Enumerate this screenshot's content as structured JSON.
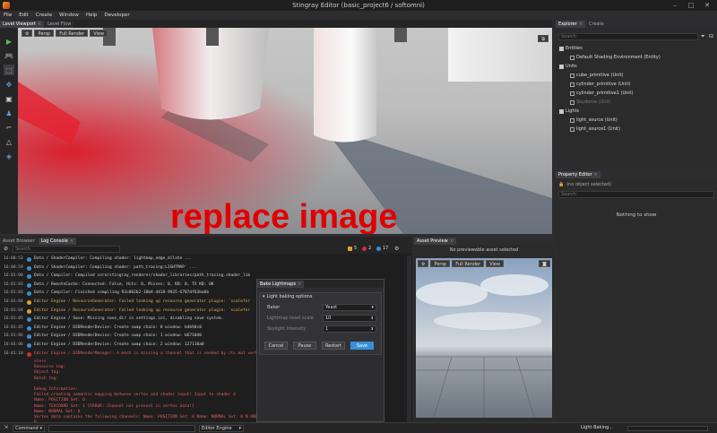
{
  "window": {
    "title": "Stingray Editor (basic_project6 / softomni)",
    "minimize": "–",
    "maximize": "□",
    "close": "✕"
  },
  "menu": [
    "File",
    "Edit",
    "Create",
    "Window",
    "Help",
    "Developer"
  ],
  "viewport_tabs": [
    "Level Viewport",
    "Level Flow"
  ],
  "viewport": {
    "mode": "Persp",
    "render": "Full Render",
    "view": "View",
    "overlay": "replace image"
  },
  "explorer": {
    "tabs": [
      "Explorer",
      "Create"
    ],
    "search_placeholder": "Search",
    "tree": [
      {
        "label": "Entities",
        "level": 0,
        "kind": "folder"
      },
      {
        "label": "Default Shading Environment (Entity)",
        "level": 1,
        "kind": "item"
      },
      {
        "label": "Units",
        "level": 0,
        "kind": "folder"
      },
      {
        "label": "cube_primitive (Unit)",
        "level": 1,
        "kind": "item"
      },
      {
        "label": "cylinder_primitive (Unit)",
        "level": 1,
        "kind": "item"
      },
      {
        "label": "cylinder_primitive1 (Unit)",
        "level": 1,
        "kind": "item"
      },
      {
        "label": "Skydome (Unit)",
        "level": 1,
        "kind": "item-dim"
      },
      {
        "label": "Lights",
        "level": 0,
        "kind": "folder"
      },
      {
        "label": "light_source (Unit)",
        "level": 1,
        "kind": "item"
      },
      {
        "label": "light_source1 (Unit)",
        "level": 1,
        "kind": "item"
      }
    ]
  },
  "property_editor": {
    "title": "Property Editor",
    "selection": "(no object selected)",
    "search_placeholder": "Search",
    "empty": "Nothing to show"
  },
  "bottom_tabs": [
    "Asset Browser",
    "Log Console"
  ],
  "log_toolbar": {
    "search_placeholder": "Search",
    "warnings": "5",
    "errors": "2",
    "infos": "17"
  },
  "log": [
    {
      "t": "16:00:53",
      "type": "info",
      "msg": "Data / ShaderCompiler: Compiling shader: lightmap_edge_dilate ..."
    },
    {
      "t": "16:00:59",
      "type": "info",
      "msg": "Data / ShaderCompiler: Compiling shader: path_tracing:LIGHTMAP' ..."
    },
    {
      "t": "16:01:00",
      "type": "info",
      "msg": "Data / Compiler: Compiled core/stingray_renderer/shader_libraries/path_tracing.shader_lib"
    },
    {
      "t": "16:01:03",
      "type": "info",
      "msg": "Data / RemoteCache: Connected: False, Hits: 0, Misses: 0, KB: 0, TX KB: 0K"
    },
    {
      "t": "16:01:03",
      "type": "info",
      "msg": "Data / Compiler: Finished compiling  93c002b2-10b4-4418-9935-6707df63ba6b"
    },
    {
      "t": "16:01:04",
      "type": "warn",
      "msg": "Editor Engine / ResourceGenerator: Failed looking up resource generator plugin: `scalefor"
    },
    {
      "t": "16:01:04",
      "type": "warn",
      "msg": "Editor Engine / ResourceGenerator: Failed looking up resource generator plugin: `scalefor"
    },
    {
      "t": "16:01:05",
      "type": "info",
      "msg": "Editor Engine / Save: Missing save_dir in settings.ini, disabling save system."
    },
    {
      "t": "16:01:05",
      "type": "info",
      "msg": "Editor Engine / D3DRenderDevice: Create swap chain: 0 window: b4b9dc0"
    },
    {
      "t": "16:01:06",
      "type": "info",
      "msg": "Editor Engine / D3DRenderDevice: Create swap chain: 1 window: b6710d0"
    },
    {
      "t": "16:01:06",
      "type": "info",
      "msg": "Editor Engine / D3DRenderDevice: Create swap chain: 2 window: 127110a0"
    },
    {
      "t": "16:01:10",
      "type": "err",
      "msg": "Editor Engine / D3DRenderManager: A mesh is missing a channel that is needed by its mat   vertex c"
    }
  ],
  "error_detail": [
    "olors",
    "Resource tag:",
    "Object tag:",
    "Batch tag:",
    "",
    "Debug Information:",
    "Failed creating semantic mapping between vertex and shader input! Input to shader d",
    "  Name: POSITION Set: 0",
    "  Name: TEXCOORD Set: 1 [ERROR: Channel not present in vertex data!]",
    "  Name: NORMAL Set: 0",
    "Vertex data contains the following channels: Name: POSITION Set: 0 Name: NORMAL Set: 0 N      ORD Set:",
    "0"
  ],
  "dialog": {
    "title": "Bake Lightmaps",
    "section": "Light baking options",
    "baker_label": "Baker",
    "baker_value": "Yeast",
    "texel_label": "Lightmap texel scale",
    "texel_value": "10",
    "sky_label": "Skylight intensity",
    "sky_value": "1",
    "cancel": "Cancel",
    "pause": "Pause",
    "restart": "Restart",
    "save": "Save"
  },
  "asset_preview": {
    "title": "Asset Preview",
    "message": "No previewable asset selected",
    "mode": "Persp",
    "render": "Full Render",
    "view": "View"
  },
  "statusbar": {
    "command_label": "Command",
    "engine": "Editor Engine",
    "task": "Light Baking..."
  }
}
